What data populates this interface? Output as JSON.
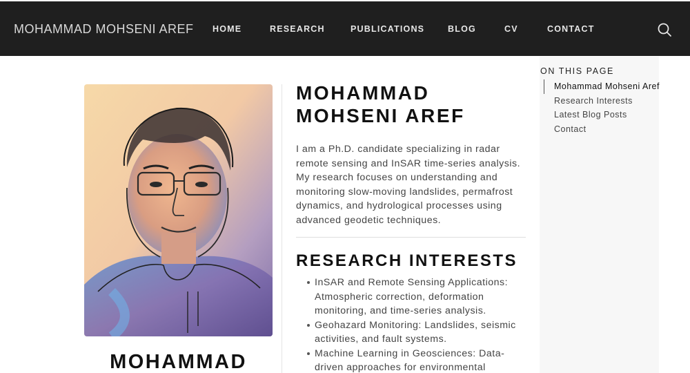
{
  "navbar": {
    "brand": "MOHAMMAD MOHSENI AREF",
    "links": [
      "HOME",
      "RESEARCH",
      "PUBLICATIONS",
      "BLOG",
      "CV",
      "CONTACT"
    ],
    "search_icon": "search-icon"
  },
  "profile": {
    "image_alt": "portrait-illustration",
    "name_first": "MOHAMMAD"
  },
  "main": {
    "title": "MOHAMMAD MOHSENI AREF",
    "intro": "I am a Ph.D. candidate specializing in radar remote sensing and InSAR time-series analysis. My research focuses on understanding and monitoring slow-moving landslides, permafrost dynamics, and hydrological processes using advanced geodetic techniques.",
    "research_heading": "RESEARCH INTERESTS",
    "interests": [
      "InSAR and Remote Sensing Applications: Atmospheric correction, deformation monitoring, and time-series analysis.",
      "Geohazard Monitoring: Landslides, seismic activities, and fault systems.",
      "Machine Learning in Geosciences: Data-driven approaches for environmental"
    ]
  },
  "toc": {
    "title": "ON THIS PAGE",
    "items": [
      "Mohammad Mohseni Aref",
      "Research Interests",
      "Latest Blog Posts",
      "Contact"
    ],
    "active_index": 0
  },
  "colors": {
    "navbar_bg": "#1f1f1f",
    "toc_bg": "#f7f7f7",
    "text": "#444444",
    "heading": "#111111"
  }
}
